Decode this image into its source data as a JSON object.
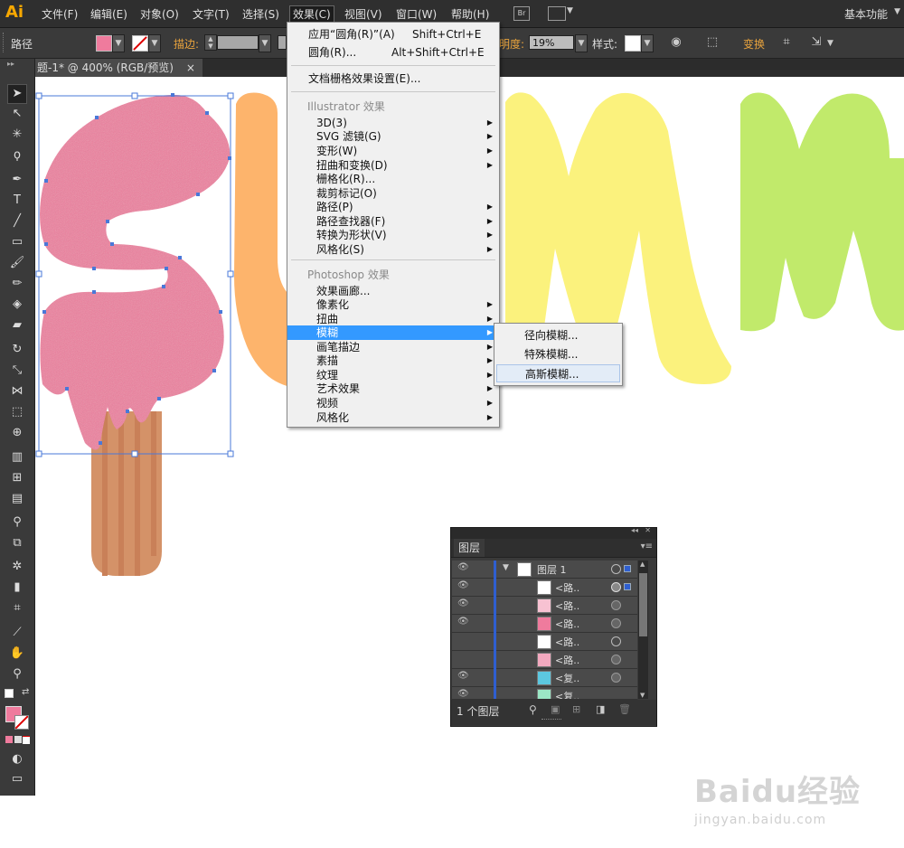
{
  "app": {
    "logo": "Ai",
    "workspace": "基本功能"
  },
  "menubar": {
    "items": [
      "文件(F)",
      "编辑(E)",
      "对象(O)",
      "文字(T)",
      "选择(S)",
      "效果(C)",
      "视图(V)",
      "窗口(W)",
      "帮助(H)"
    ],
    "bridge": "Br"
  },
  "control": {
    "object_type": "路径",
    "stroke_label": "描边:",
    "opacity_label": "明度:",
    "opacity_value": "19%",
    "style_label": "样式:",
    "transform_label": "变换"
  },
  "document": {
    "tab_title": "题-1* @ 400% (RGB/预览)",
    "close": "×"
  },
  "effect_menu": {
    "apply_last": "应用“圆角(R)”(A)",
    "apply_last_shortcut": "Shift+Ctrl+E",
    "last_effect": "圆角(R)...",
    "last_effect_shortcut": "Alt+Shift+Ctrl+E",
    "raster_settings": "文档栅格效果设置(E)...",
    "illustrator_header": "Illustrator 效果",
    "illustrator_items": [
      "3D(3)",
      "SVG 滤镜(G)",
      "变形(W)",
      "扭曲和变换(D)",
      "栅格化(R)...",
      "裁剪标记(O)",
      "路径(P)",
      "路径查找器(F)",
      "转换为形状(V)",
      "风格化(S)"
    ],
    "photoshop_header": "Photoshop 效果",
    "photoshop_items": [
      "效果画廊...",
      "像素化",
      "扭曲",
      "模糊",
      "画笔描边",
      "素描",
      "纹理",
      "艺术效果",
      "视频",
      "风格化"
    ]
  },
  "blur_submenu": {
    "items": [
      "径向模糊...",
      "特殊模糊...",
      "高斯模糊..."
    ]
  },
  "layers_panel": {
    "tab": "图层",
    "top_layer": "图层 1",
    "rows": [
      "<路..",
      "<路..",
      "<路..",
      "<路..",
      "<路..",
      "<复..",
      "<复.."
    ],
    "footer_count": "1 个图层"
  },
  "watermark": {
    "main": "Baidu经验",
    "sub": "jingyan.baidu.com"
  },
  "colors": {
    "fill": "#ef7b9d",
    "menu_highlight": "#3399ff",
    "letter_orange": "#fdb46c",
    "letter_yellow": "#fbf27d",
    "letter_green": "#c1ea6b",
    "stick": "#d49268"
  }
}
